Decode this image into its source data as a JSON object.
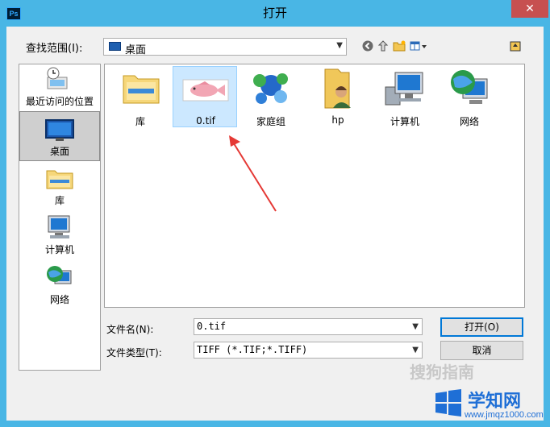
{
  "window": {
    "title": "打开",
    "app_badge": "Ps",
    "close_glyph": "✕"
  },
  "lookin": {
    "label": "查找范围(I):",
    "value": "桌面"
  },
  "toolbar": {
    "back": "◀",
    "up": "⇧",
    "new_folder": "📁",
    "views": "▦▾",
    "extra": "▣"
  },
  "sidebar": {
    "items": [
      {
        "label": "最近访问的位置"
      },
      {
        "label": "桌面"
      },
      {
        "label": "库"
      },
      {
        "label": "计算机"
      },
      {
        "label": "网络"
      }
    ]
  },
  "files": [
    {
      "label": "库"
    },
    {
      "label": "0.tif"
    },
    {
      "label": "家庭组"
    },
    {
      "label": "hp"
    },
    {
      "label": "计算机"
    },
    {
      "label": "网络"
    }
  ],
  "filename": {
    "label": "文件名(N):",
    "value": "0.tif"
  },
  "filetype": {
    "label": "文件类型(T):",
    "value": "TIFF (*.TIF;*.TIFF)"
  },
  "buttons": {
    "open": "打开(O)",
    "cancel": "取消"
  },
  "watermarks": {
    "sogou": "搜狗指南",
    "site_name": "学知网",
    "site_url": "www.jmqz1000.com"
  },
  "colors": {
    "titlebar": "#49b6e5",
    "selection": "#cce8ff",
    "arrow": "#e53935"
  }
}
